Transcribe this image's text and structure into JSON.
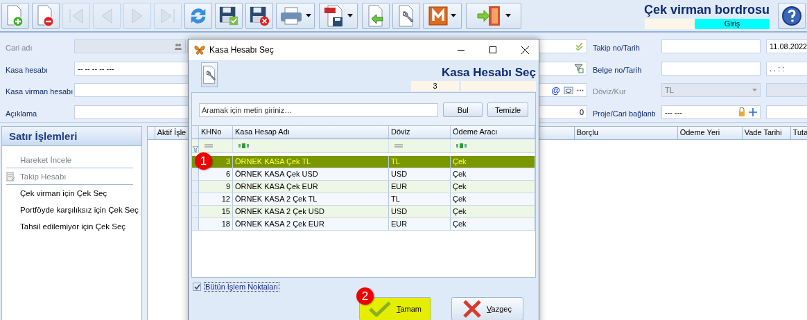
{
  "toolbar": {
    "buttons": [
      {
        "kind": "new",
        "disabled": false,
        "dropdown": false
      },
      {
        "kind": "delete",
        "disabled": false,
        "dropdown": false
      },
      {
        "kind": "first",
        "disabled": true,
        "dropdown": false
      },
      {
        "kind": "prev",
        "disabled": true,
        "dropdown": false
      },
      {
        "kind": "next",
        "disabled": true,
        "dropdown": false
      },
      {
        "kind": "last",
        "disabled": true,
        "dropdown": false
      },
      {
        "kind": "refresh",
        "disabled": false,
        "dropdown": false
      },
      {
        "kind": "save",
        "disabled": false,
        "dropdown": false
      },
      {
        "kind": "save_cancel",
        "disabled": false,
        "dropdown": false
      },
      {
        "kind": "print",
        "disabled": false,
        "dropdown": true
      },
      {
        "kind": "pdf",
        "disabled": false,
        "dropdown": true
      },
      {
        "kind": "import",
        "disabled": false,
        "dropdown": false
      },
      {
        "kind": "tools",
        "disabled": false,
        "dropdown": false
      },
      {
        "kind": "m",
        "disabled": false,
        "dropdown": true
      },
      {
        "kind": "exit",
        "disabled": false,
        "dropdown": true
      }
    ],
    "title": "Çek virman bordrosu",
    "mode": "Giriş"
  },
  "form": {
    "left": [
      {
        "label": "Cari adı",
        "disabled": true,
        "split": true,
        "adornments": [
          {
            "kind": "check"
          }
        ]
      },
      {
        "label": "Kasa hesabı",
        "disabled": false,
        "value": "-- -- -- -- ---",
        "split": false,
        "adornments": [
          {
            "kind": "filter"
          }
        ]
      },
      {
        "label": "Kasa virman hesabı",
        "disabled": false,
        "split": false,
        "adornments": [
          {
            "kind": "text",
            "text": "@"
          },
          {
            "kind": "eye"
          },
          {
            "kind": "dots"
          }
        ]
      },
      {
        "label": "Açıklama",
        "disabled": false,
        "value": "0",
        "split": false
      }
    ],
    "right": [
      {
        "label": "Takip no/Tarih",
        "disabled": false,
        "second": "11.08.2022",
        "kind": "input"
      },
      {
        "label": "Belge no/Tarih",
        "disabled": false,
        "second": ".  .      :  :",
        "kind": "input"
      },
      {
        "label": "Döviz/Kur",
        "disabled": true,
        "value": "TL",
        "kind": "select"
      },
      {
        "label": "Proje/Cari bağlantı",
        "disabled": false,
        "value": "--- ---",
        "kind": "link"
      }
    ]
  },
  "sidebar": {
    "title": "Satır İşlemleri",
    "items": [
      {
        "label": "Hareket İncele",
        "disabled": true,
        "icon": false
      },
      {
        "label": "Takip Hesabı",
        "disabled": true,
        "icon": true
      },
      {
        "label": "Çek virman için Çek Seç",
        "disabled": false,
        "icon": false
      },
      {
        "label": "Portföyde karşılıksız için Çek Seç",
        "disabled": false,
        "icon": false
      },
      {
        "label": "Tahsil edilemiyor için Çek Seç",
        "disabled": false,
        "icon": false
      }
    ]
  },
  "grid": {
    "columns": [
      "Aktif İşle",
      "Borçlu",
      "Ödeme Yeri",
      "Vade Tarihi",
      "Tuta"
    ]
  },
  "dialog": {
    "title": "Kasa Hesabı Seç",
    "heading": "Kasa Hesabı Seç",
    "selected_id": "3",
    "search": {
      "placeholder": "Aramak için metin giriniz…"
    },
    "search_buttons": [
      "Bul",
      "Temizle"
    ],
    "table": {
      "annotation": "1",
      "columns": [
        {
          "label": "KHNo",
          "kind": "equals"
        },
        {
          "label": "Kasa Hesap Adı",
          "kind": "text"
        },
        {
          "label": "Döviz",
          "kind": "equals"
        },
        {
          "label": "Ödeme Aracı",
          "kind": "text"
        }
      ],
      "rows": [
        {
          "no": "3",
          "name": "ÖRNEK KASA Çek TL",
          "currency": "TL",
          "payment": "Çek",
          "selected": true
        },
        {
          "no": "6",
          "name": "ÖRNEK KASA Çek USD",
          "currency": "USD",
          "payment": "Çek",
          "selected": false
        },
        {
          "no": "9",
          "name": "ÖRNEK KASA Çek EUR",
          "currency": "EUR",
          "payment": "Çek",
          "selected": false
        },
        {
          "no": "12",
          "name": "ÖRNEK KASA 2 Çek TL",
          "currency": "TL",
          "payment": "Çek",
          "selected": false
        },
        {
          "no": "15",
          "name": "ÖRNEK KASA 2 Çek USD",
          "currency": "USD",
          "payment": "Çek",
          "selected": false
        },
        {
          "no": "18",
          "name": "ÖRNEK KASA 2 Çek EUR",
          "currency": "EUR",
          "payment": "Çek",
          "selected": false
        }
      ]
    },
    "all_points": {
      "label": "Bütün İşlem Noktaları",
      "checked": true
    },
    "buttons": [
      {
        "kind": "ok",
        "label": "Tamam",
        "highlighted": true,
        "annotation": "2"
      },
      {
        "kind": "cancel",
        "label": "Vazgeç",
        "highlighted": false
      }
    ]
  }
}
